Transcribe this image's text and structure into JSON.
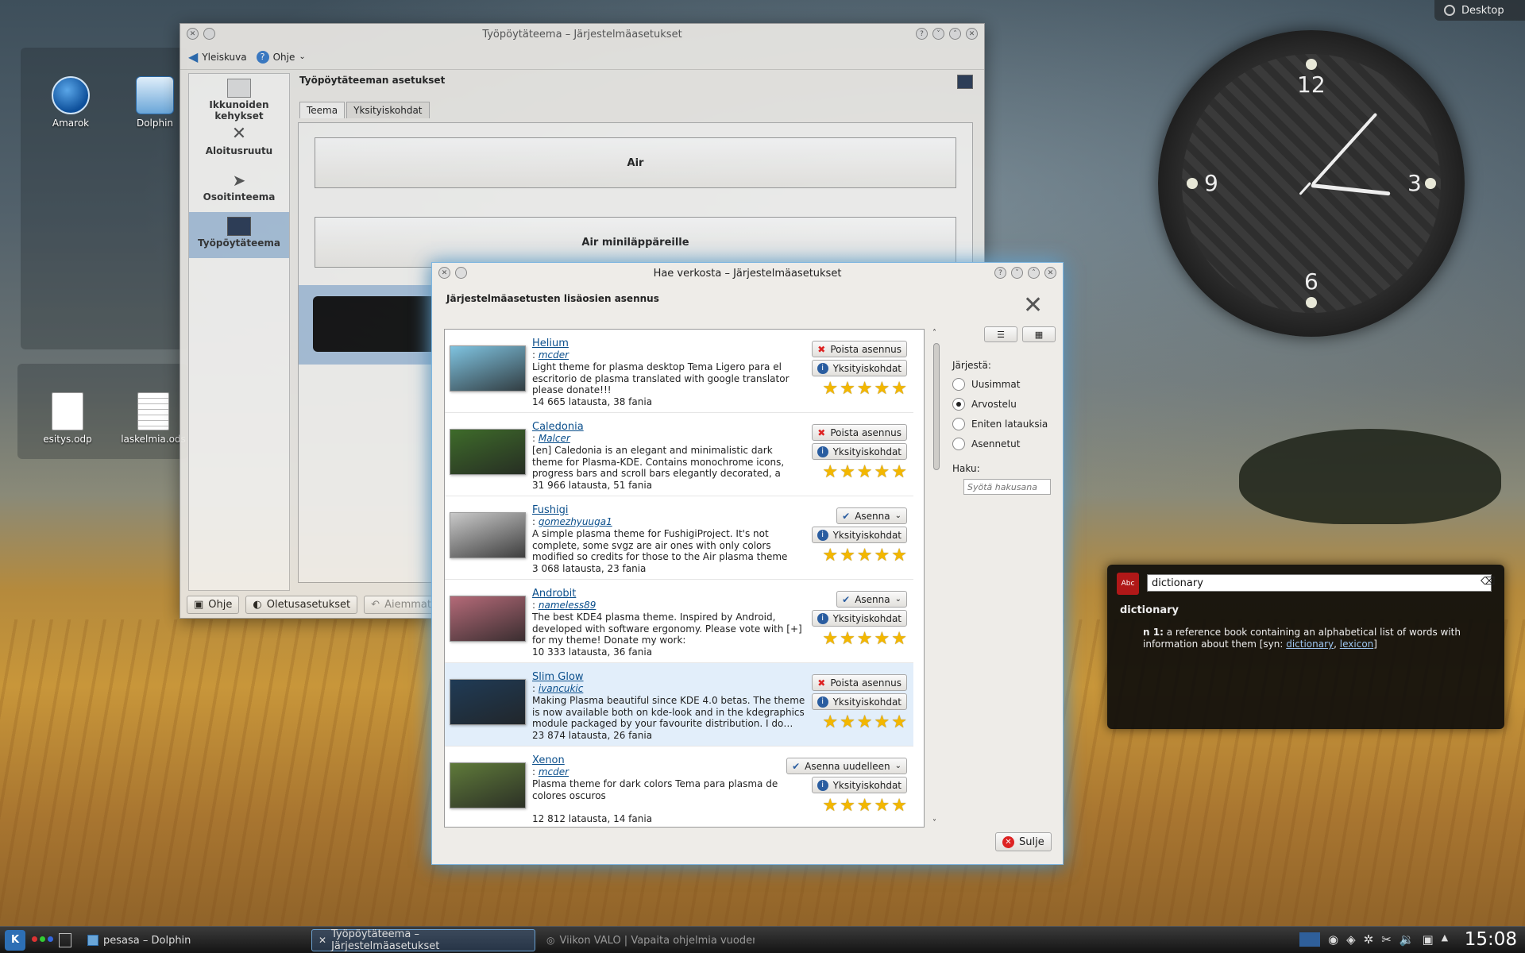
{
  "desktop": {
    "button_label": "Desktop",
    "icons": [
      {
        "label": "Amarok"
      },
      {
        "label": "Dolphin"
      },
      {
        "label": "esitys.odp"
      },
      {
        "label": "laskelmia.ods"
      }
    ]
  },
  "clock": {
    "n12": "12",
    "n3": "3",
    "n6": "6",
    "n9": "9"
  },
  "settings_window": {
    "title": "Työpöytäteema – Järjestelmäasetukset",
    "toolbar": {
      "overview": "Yleiskuva",
      "help": "Ohje"
    },
    "heading": "Työpöytäteeman asetukset",
    "sidebar": [
      {
        "label": "Ikkunoiden kehykset"
      },
      {
        "label": "Aloitusruutu"
      },
      {
        "label": "Osoitinteema"
      },
      {
        "label": "Työpöytäteema"
      }
    ],
    "tabs": [
      "Teema",
      "Yksityiskohdat"
    ],
    "themes": [
      "Air",
      "Air miniläppäreille"
    ],
    "footer": {
      "help": "Ohje",
      "defaults": "Oletusasetukset",
      "previous": "Aiemmat"
    }
  },
  "ghns_dialog": {
    "title": "Hae verkosta – Järjestelmäasetukset",
    "heading": "Järjestelmäasetusten lisäosien asennus",
    "items": [
      {
        "name": "Helium",
        "author": "mcder",
        "description": "Light theme for plasma desktop Tema Ligero para el escritorio de plasma translated with google translator please donate!!!",
        "stats": "14 665 latausta, 38 fania",
        "primary": "Poista asennus",
        "primary_kind": "remove",
        "details": "Yksityiskohdat",
        "color": "#7fc3e0"
      },
      {
        "name": "Caledonia",
        "author": "Malcer",
        "description": "[en] Caledonia is an elegant and minimalistic dark theme for Plasma-KDE. Contains monochrome icons, progress bars and scroll bars elegantly decorated, a minimalist logout, and m…",
        "stats": "31 966 latausta, 51 fania",
        "primary": "Poista asennus",
        "primary_kind": "remove",
        "details": "Yksityiskohdat",
        "color": "#3e6b2a"
      },
      {
        "name": "Fushigi",
        "author": "gomezhyuuga1",
        "description": "A simple plasma theme for FushigiProject. It's not complete, some svgz are air ones with only colors modified so credits for those to the Air plasma theme designers. For daily updat…",
        "stats": "3 068 latausta, 23 fania",
        "primary": "Asenna",
        "primary_kind": "install",
        "details": "Yksityiskohdat",
        "color": "#c9c9c9"
      },
      {
        "name": "Androbit",
        "author": "nameless89",
        "description": "The best KDE4 plasma theme. Inspired by Android, developed with software ergonomy. Please vote with [+] for my theme! Donate my work: https://www.paypal.com/cgi-bin/websc…",
        "stats": "10 333 latausta, 36 fania",
        "primary": "Asenna",
        "primary_kind": "install",
        "details": "Yksityiskohdat",
        "color": "#b46a78"
      },
      {
        "name": "Slim Glow",
        "author": "ivancukic",
        "description": "Making Plasma beautiful since KDE 4.0 betas. The theme is now available both on kde-look and in the kdegraphics module packaged by your favourite distribution. I do…",
        "stats": "23 874 latausta, 26 fania",
        "primary": "Poista asennus",
        "primary_kind": "remove",
        "details": "Yksityiskohdat",
        "color": "#1f3b56"
      },
      {
        "name": "Xenon",
        "author": "mcder",
        "description": "Plasma theme for dark colors Tema para plasma de colores oscuros",
        "stats": "12 812 latausta, 14 fania",
        "primary": "Asenna uudelleen",
        "primary_kind": "install",
        "details": "Yksityiskohdat",
        "color": "#5f7a3a"
      }
    ],
    "sort_label": "Järjestä:",
    "sort_options": [
      {
        "label": "Uusimmat",
        "selected": false
      },
      {
        "label": "Arvostelu",
        "selected": true
      },
      {
        "label": "Eniten latauksia",
        "selected": false
      },
      {
        "label": "Asennetut",
        "selected": false
      }
    ],
    "search_label": "Haku:",
    "search_placeholder": "Syötä hakusana",
    "close": "Sulje"
  },
  "dictionary": {
    "query": "dictionary",
    "word": "dictionary",
    "sense": "n 1:",
    "definition": "a reference book containing an alphabetical list of words with information about them [syn:",
    "syn1": "dictionary",
    "syn2": "lexicon",
    "end": "]"
  },
  "taskbar": {
    "tasks": [
      "pesasa – Dolphin",
      "Työpöytäteema – Järjestelmäasetukset",
      "Viikon VALO | Vapaita ohjelmia vuoden jokais"
    ],
    "time": "15:08"
  }
}
